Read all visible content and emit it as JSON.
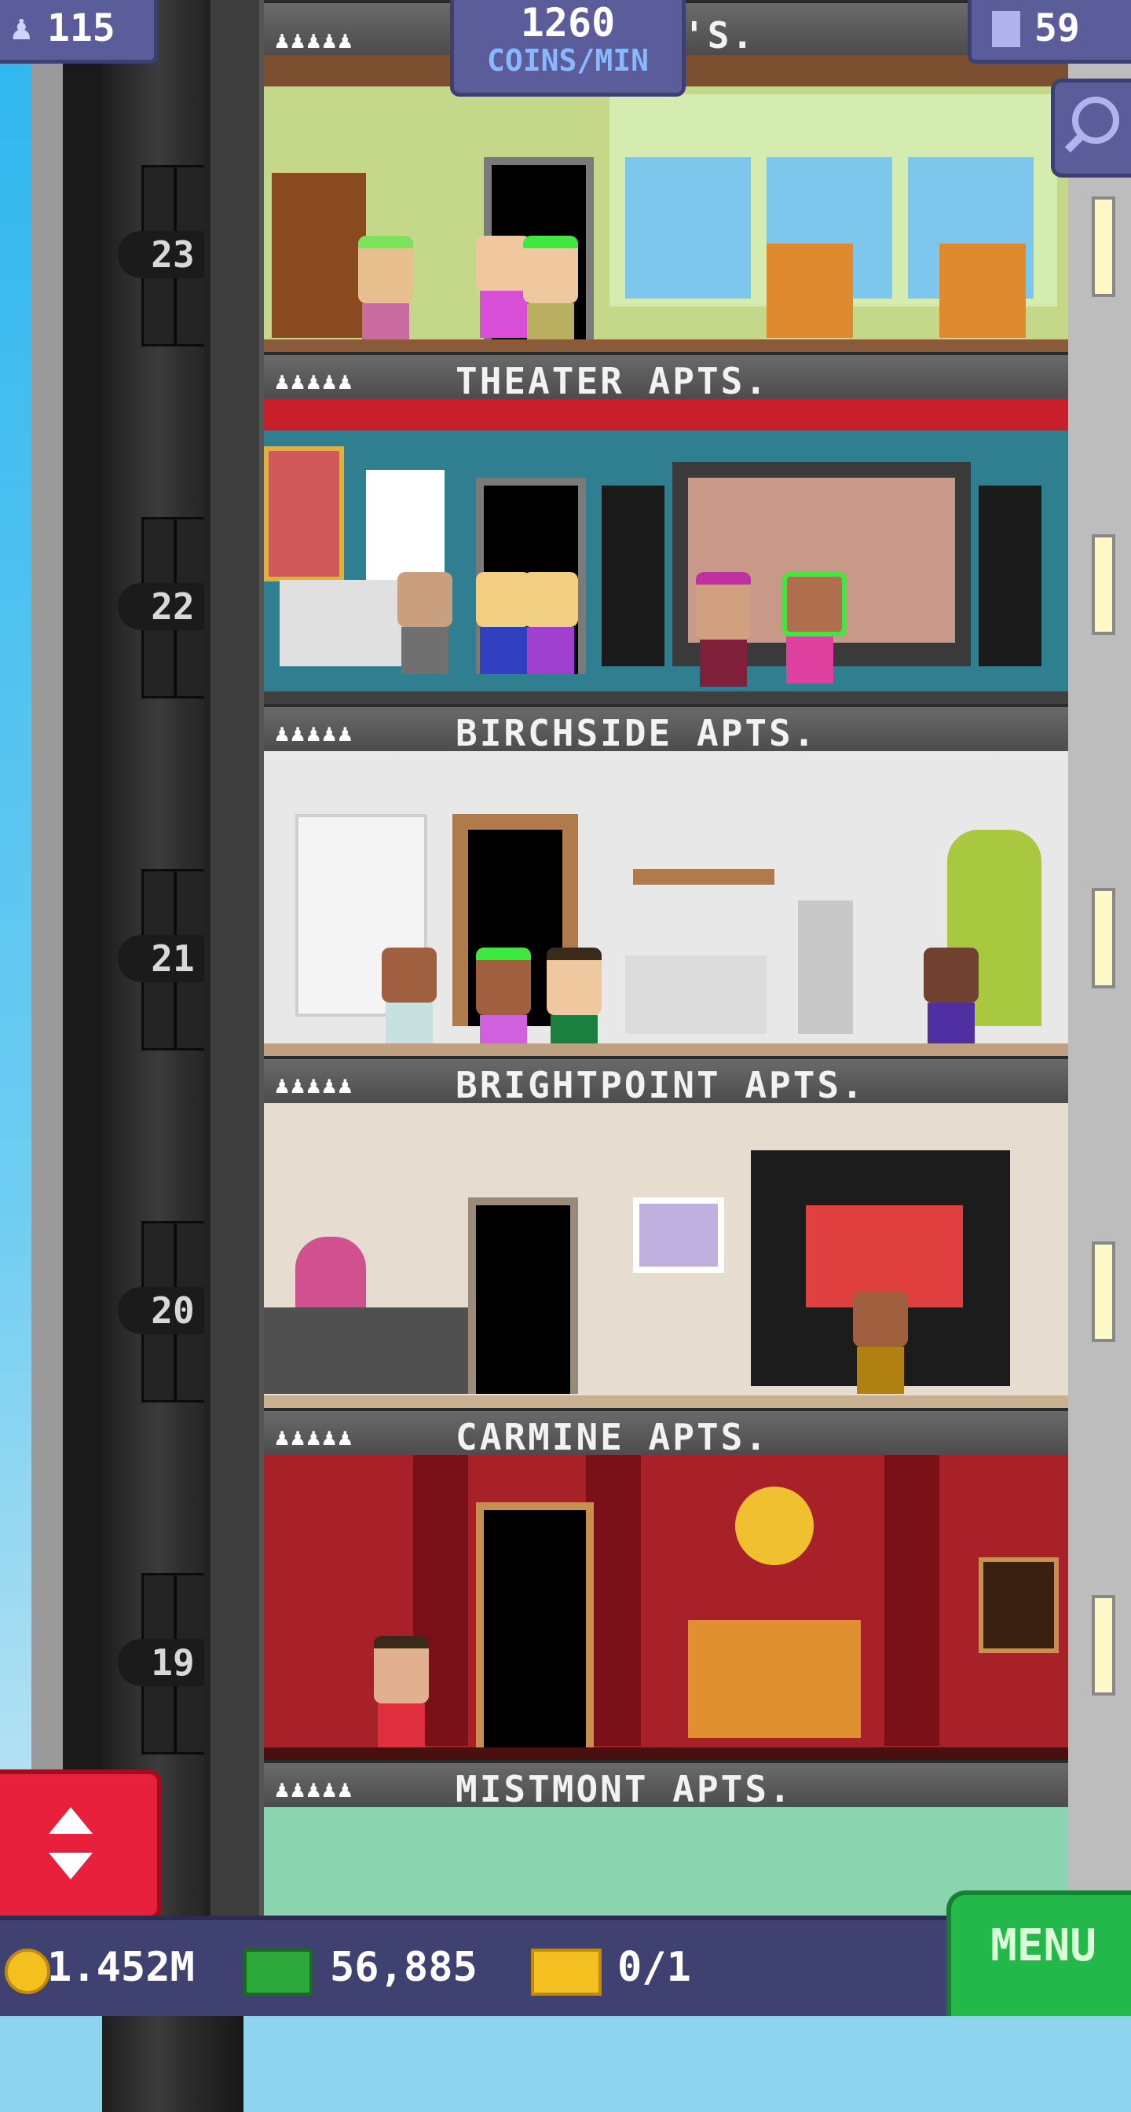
{
  "hud": {
    "population": "115",
    "coins_rate_value": "1260",
    "coins_rate_unit": "COINS/MIN",
    "floors_count": "59",
    "partial_label": "'S."
  },
  "floors": [
    {
      "number": "23",
      "name": "THEATER APTS."
    },
    {
      "number": "22",
      "name": "BIRCHSIDE APTS."
    },
    {
      "number": "21",
      "name": "BRIGHTPOINT APTS."
    },
    {
      "number": "20",
      "name": "CARMINE APTS."
    },
    {
      "number": "19",
      "name": "MISTMONT APTS."
    }
  ],
  "resident_icons": "♟♟♟♟♟",
  "bottom": {
    "coins": "1.452M",
    "bux": "56,885",
    "tickets": "0/1",
    "menu_label": "MENU"
  },
  "icons": {
    "population": "person-icon",
    "floors": "building-icon",
    "zoom": "zoom-out-icon",
    "coin": "coin-icon",
    "bux": "bux-icon",
    "ticket": "ticket-icon",
    "elevator": "elevator-arrows-icon"
  },
  "colors": {
    "hud_bg": "#5b5d9a",
    "menu_green": "#22b84a",
    "elevator_red": "#e8203c"
  }
}
